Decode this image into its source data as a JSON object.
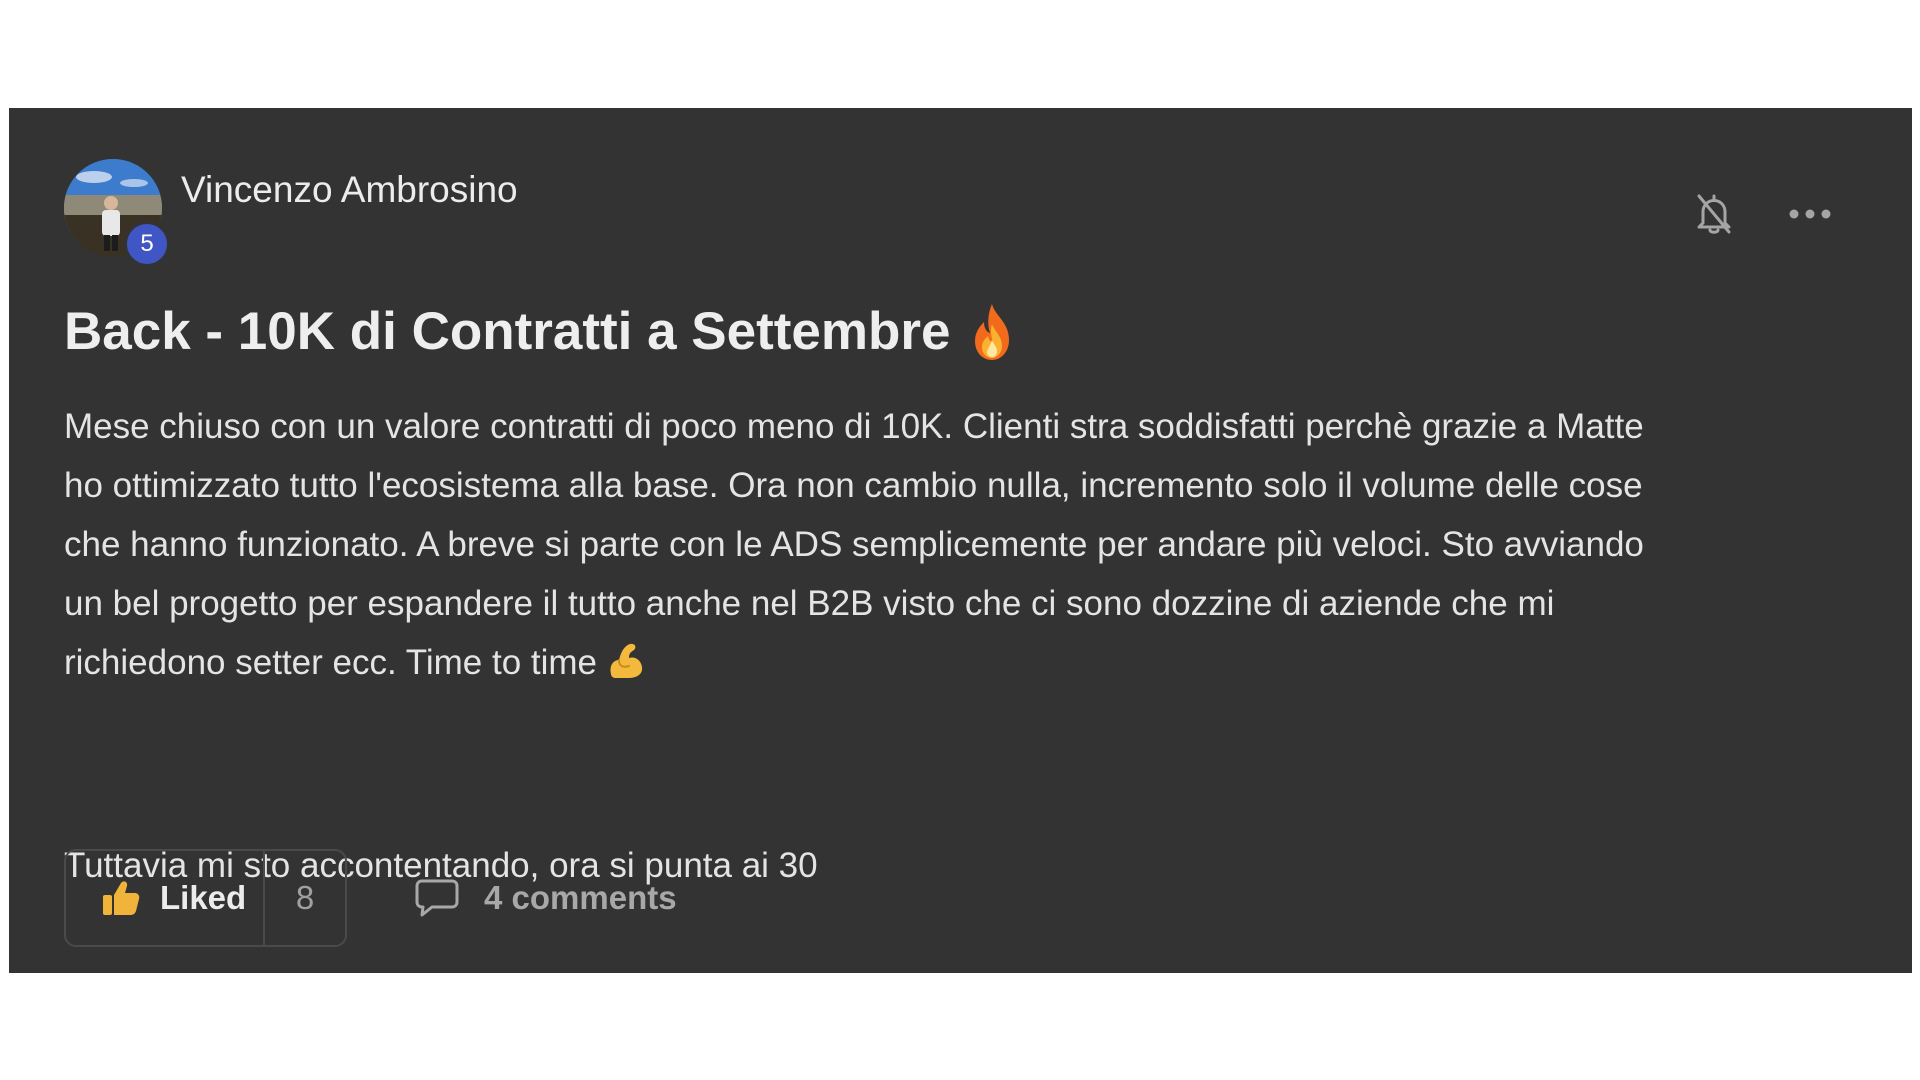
{
  "post": {
    "author": {
      "name": "Vincenzo Ambrosino",
      "level": "5"
    },
    "title": "Back - 10K di Contratti a Settembre",
    "title_emoji": "fire-emoji",
    "body_lines": [
      "Mese chiuso con un valore contratti di poco meno di 10K. Clienti stra soddisfatti perchè grazie a Matte",
      "ho ottimizzato tutto l'ecosistema alla base. Ora non cambio nulla, incremento solo il volume delle cose",
      "che hanno funzionato. A breve si parte con le ADS semplicemente per andare più veloci. Sto avviando",
      "un bel progetto per espandere il tutto anche nel B2B visto che ci sono dozzine di aziende che mi",
      "richiedono setter ecc. Time to time"
    ],
    "body_emoji": "flexed-biceps-emoji",
    "body_paragraph_2": "Tuttavia mi sto accontentando, ora si punta ai 30",
    "actions": {
      "like_label": "Liked",
      "like_count": "8",
      "comments_label": "4 comments"
    },
    "icons": {
      "bell": "bell-off-icon",
      "more": "more-horizontal-icon",
      "like": "thumbs-up-icon",
      "comment": "comment-icon"
    }
  },
  "colors": {
    "card_background": "#333333",
    "page_background": "#ffffff",
    "level_badge": "#3f56c4",
    "like_icon": "#f0b43a",
    "text_primary": "#eeeeee",
    "text_muted": "#a0a0a0"
  }
}
